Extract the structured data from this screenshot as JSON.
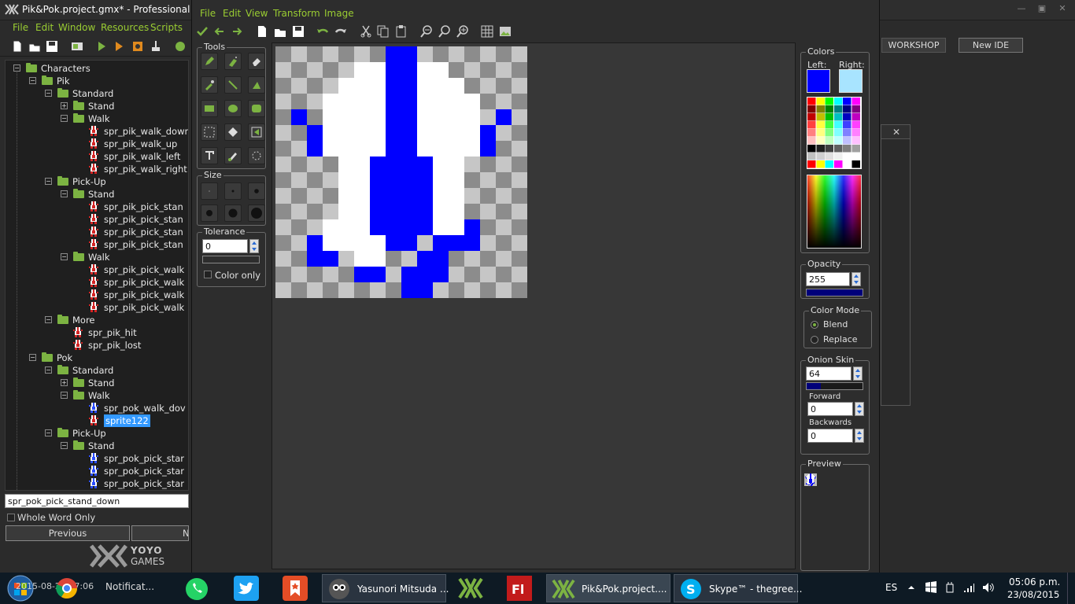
{
  "main": {
    "title": "Pik&Pok.project.gmx*  -  Professional Ec",
    "menu": [
      "File",
      "Edit",
      "Window",
      "Resources",
      "Scripts"
    ],
    "workshop_label": "WORKSHOP",
    "new_ide_label": "New IDE"
  },
  "tree": {
    "rows": [
      {
        "label": "Characters",
        "type": "folder",
        "depth": 0,
        "open": true
      },
      {
        "label": "Pik",
        "type": "folder",
        "depth": 1,
        "open": true
      },
      {
        "label": "Standard",
        "type": "folder",
        "depth": 2,
        "open": true
      },
      {
        "label": "Stand",
        "type": "folder",
        "depth": 3,
        "open": false
      },
      {
        "label": "Walk",
        "type": "folder",
        "depth": 3,
        "open": true
      },
      {
        "label": "spr_pik_walk_down",
        "type": "sprite-red",
        "depth": 4
      },
      {
        "label": "spr_pik_walk_up",
        "type": "sprite-red",
        "depth": 4
      },
      {
        "label": "spr_pik_walk_left",
        "type": "sprite-red",
        "depth": 4
      },
      {
        "label": "spr_pik_walk_right",
        "type": "sprite-red",
        "depth": 4
      },
      {
        "label": "Pick-Up",
        "type": "folder",
        "depth": 2,
        "open": true
      },
      {
        "label": "Stand",
        "type": "folder",
        "depth": 3,
        "open": true
      },
      {
        "label": "spr_pik_pick_stan",
        "type": "sprite-red",
        "depth": 4
      },
      {
        "label": "spr_pik_pick_stan",
        "type": "sprite-red",
        "depth": 4
      },
      {
        "label": "spr_pik_pick_stan",
        "type": "sprite-red",
        "depth": 4
      },
      {
        "label": "spr_pik_pick_stan",
        "type": "sprite-red",
        "depth": 4
      },
      {
        "label": "Walk",
        "type": "folder",
        "depth": 3,
        "open": true
      },
      {
        "label": "spr_pik_pick_walk",
        "type": "sprite-red",
        "depth": 4
      },
      {
        "label": "spr_pik_pick_walk",
        "type": "sprite-red",
        "depth": 4
      },
      {
        "label": "spr_pik_pick_walk",
        "type": "sprite-red",
        "depth": 4
      },
      {
        "label": "spr_pik_pick_walk",
        "type": "sprite-red",
        "depth": 4
      },
      {
        "label": "More",
        "type": "folder",
        "depth": 2,
        "open": true
      },
      {
        "label": "spr_pik_hit",
        "type": "sprite-red",
        "depth": 3
      },
      {
        "label": "spr_pik_lost",
        "type": "sprite-red",
        "depth": 3
      },
      {
        "label": "Pok",
        "type": "folder",
        "depth": 1,
        "open": true
      },
      {
        "label": "Standard",
        "type": "folder",
        "depth": 2,
        "open": true
      },
      {
        "label": "Stand",
        "type": "folder",
        "depth": 3,
        "open": false
      },
      {
        "label": "Walk",
        "type": "folder",
        "depth": 3,
        "open": true
      },
      {
        "label": "spr_pok_walk_dov",
        "type": "sprite-blue",
        "depth": 4
      },
      {
        "label": "sprite122",
        "type": "sprite-red",
        "depth": 4,
        "selected": true
      },
      {
        "label": "Pick-Up",
        "type": "folder",
        "depth": 2,
        "open": true
      },
      {
        "label": "Stand",
        "type": "folder",
        "depth": 3,
        "open": true
      },
      {
        "label": "spr_pok_pick_star",
        "type": "sprite-blue",
        "depth": 4
      },
      {
        "label": "spr_pok_pick_star",
        "type": "sprite-blue",
        "depth": 4
      },
      {
        "label": "spr_pok_pick_star",
        "type": "sprite-blue",
        "depth": 4
      }
    ]
  },
  "search": {
    "value": "spr_pok_pick_stand_down",
    "whole_word_label": "Whole Word Only",
    "previous_label": "Previous",
    "next_label": "N"
  },
  "branding": {
    "yoyo": "YOYO",
    "games": "GAMES"
  },
  "editor": {
    "menu": [
      "File",
      "Edit",
      "View",
      "Transform",
      "Image"
    ],
    "tools_title": "Tools",
    "size_title": "Size",
    "tolerance_title": "Tolerance",
    "tolerance_value": "0",
    "color_only_label": "Color only",
    "colors_title": "Colors",
    "left_label": "Left:",
    "right_label": "Right:",
    "left_color": "#0000ff",
    "right_color": "#a8e4ff",
    "opacity_title": "Opacity",
    "opacity_value": "255",
    "color_mode_title": "Color Mode",
    "blend_label": "Blend",
    "replace_label": "Replace",
    "onion_title": "Onion Skin",
    "onion_value": "64",
    "forward_label": "Forward",
    "forward_value": "0",
    "backwards_label": "Backwards",
    "backwards_value": "0",
    "preview_title": "Preview"
  },
  "taskbar": {
    "apps": [
      {
        "label": "Yasunori Mitsuda ...",
        "icon": "media-player-icon"
      },
      {
        "label": "Pik&Pok.project....",
        "icon": "gamemaker-icon"
      },
      {
        "label": "Skype™ - thegree...",
        "icon": "skype-icon"
      }
    ],
    "chrome_overlay": "Notificat...",
    "overlay_date": "2015-08-23 17:06",
    "language": "ES",
    "time": "05:06 p.m.",
    "date": "23/08/2015"
  },
  "colors": {
    "accent_green": "#7cb342",
    "sprite_blue": "#0000ff",
    "selection": "#3399ff"
  }
}
